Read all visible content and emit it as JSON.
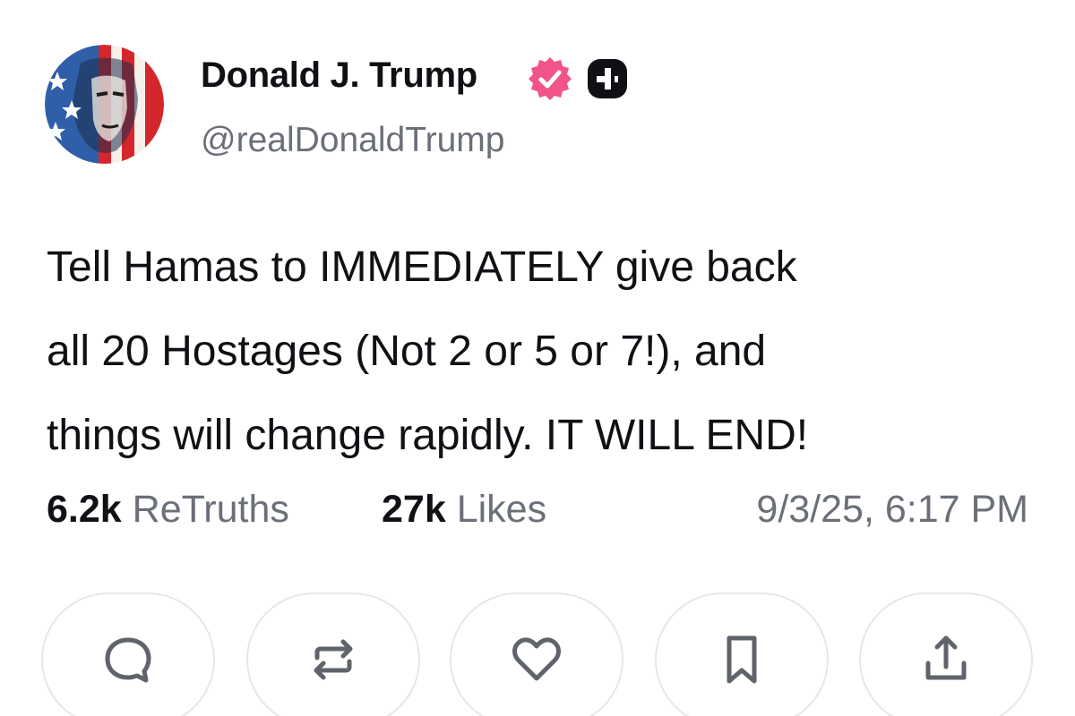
{
  "author": {
    "display_name": "Donald J. Trump",
    "handle": "@realDonaldTrump",
    "verified_icon": "verified-checkmark-icon",
    "verified_color": "#f0548a",
    "plus_icon": "plus-badge-icon"
  },
  "post": {
    "lines": [
      "Tell Hamas to IMMEDIATELY give back",
      "all 20 Hostages (Not 2 or 5 or 7!), and",
      "things will change rapidly. IT WILL END!"
    ]
  },
  "stats": {
    "retruths_count": "6.2k",
    "retruths_label": "ReTruths",
    "likes_count": "27k",
    "likes_label": "Likes",
    "timestamp": "9/3/25, 6:17 PM"
  },
  "actions": [
    {
      "icon": "reply-icon"
    },
    {
      "icon": "retruth-icon"
    },
    {
      "icon": "like-heart-icon"
    },
    {
      "icon": "bookmark-icon"
    },
    {
      "icon": "share-icon"
    }
  ],
  "colors": {
    "text": "#0f1115",
    "muted": "#6b6f78",
    "icon": "#5f636b",
    "border": "#e5e7eb"
  }
}
